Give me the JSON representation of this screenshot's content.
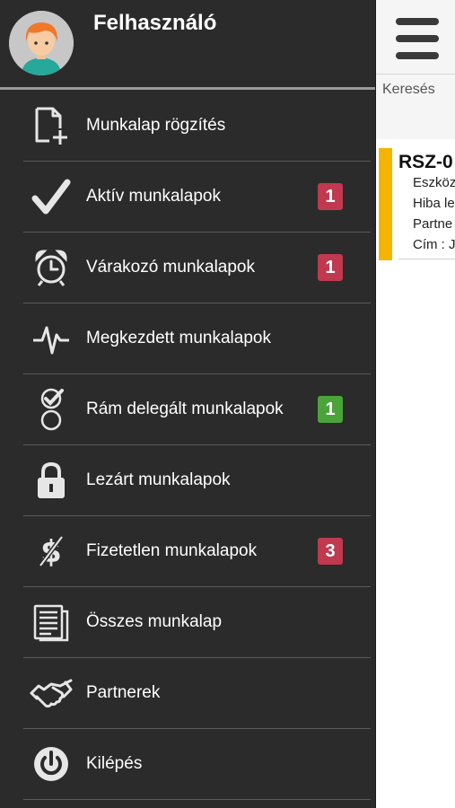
{
  "user": {
    "name": "Felhasználó"
  },
  "menu": [
    {
      "label": "Munkalap rögzítés",
      "icon": "add-document-icon",
      "badge": null
    },
    {
      "label": "Aktív munkalapok",
      "icon": "checkmark-icon",
      "badge": "1",
      "badge_color": "#c0394f"
    },
    {
      "label": "Várakozó munkalapok",
      "icon": "alarm-clock-icon",
      "badge": "1",
      "badge_color": "#c0394f"
    },
    {
      "label": "Megkezdett munkalapok",
      "icon": "pulse-icon",
      "badge": null
    },
    {
      "label": "Rám delegált munkalapok",
      "icon": "delegated-check-icon",
      "badge": "1",
      "badge_color": "#4aa43a"
    },
    {
      "label": "Lezárt munkalapok",
      "icon": "lock-icon",
      "badge": null
    },
    {
      "label": "Fizetetlen munkalapok",
      "icon": "unpaid-dollar-icon",
      "badge": "3",
      "badge_color": "#c0394f"
    },
    {
      "label": "Összes munkalap",
      "icon": "document-list-icon",
      "badge": null
    },
    {
      "label": "Partnerek",
      "icon": "handshake-icon",
      "badge": null
    },
    {
      "label": "Kilépés",
      "icon": "power-icon",
      "badge": null
    }
  ],
  "content": {
    "search_label": "Keresés",
    "card": {
      "title": "RSZ-0",
      "lines": [
        "Eszköz",
        "Hiba le",
        "Partne",
        "Cím : J"
      ],
      "accent_color": "#f5b400"
    }
  },
  "colors": {
    "drawer_bg": "#2b2b2b",
    "badge_red": "#c0394f",
    "badge_green": "#4aa43a"
  }
}
